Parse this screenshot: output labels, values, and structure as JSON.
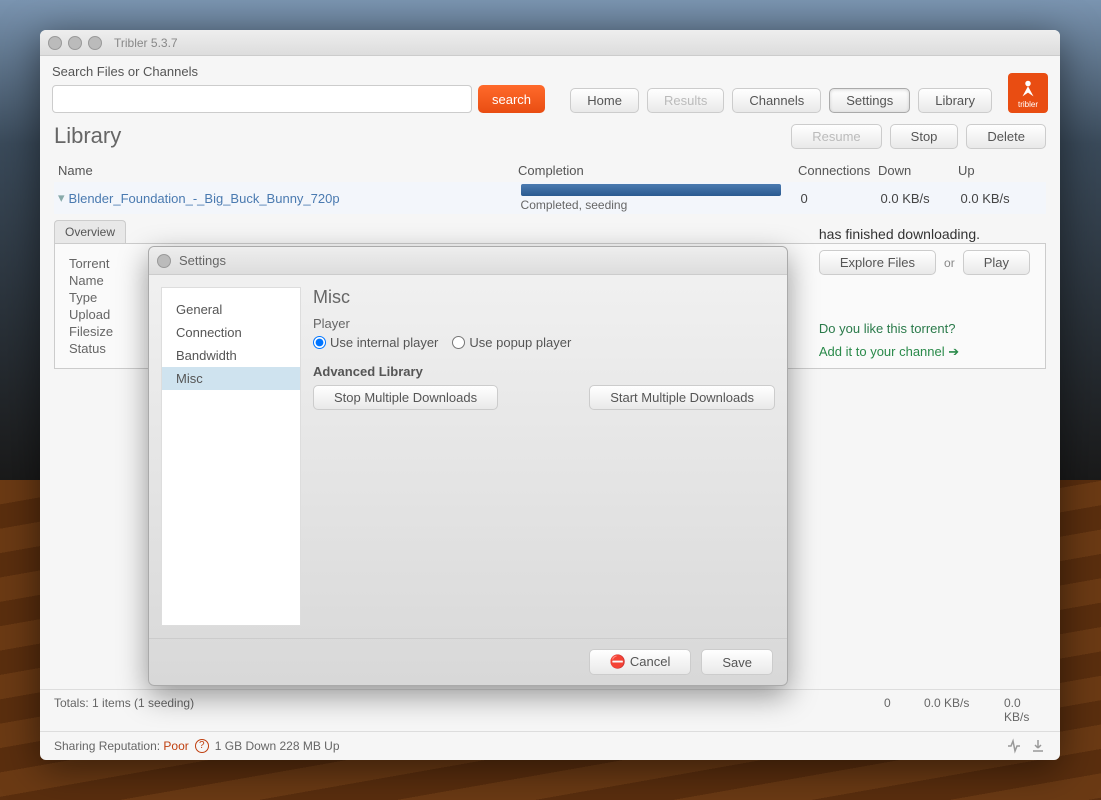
{
  "window": {
    "title": "Tribler 5.3.7"
  },
  "search": {
    "label": "Search Files or Channels",
    "placeholder": "",
    "button": "search"
  },
  "nav": {
    "home": "Home",
    "results": "Results",
    "channels": "Channels",
    "settings": "Settings",
    "library": "Library",
    "logo": "tribler"
  },
  "library": {
    "title": "Library",
    "actions": {
      "resume": "Resume",
      "stop": "Stop",
      "delete": "Delete"
    },
    "columns": {
      "name": "Name",
      "completion": "Completion",
      "connections": "Connections",
      "down": "Down",
      "up": "Up"
    },
    "row": {
      "name": "Blender_Foundation_-_Big_Buck_Bunny_720p",
      "status": "Completed, seeding",
      "connections": "0",
      "down": "0.0 KB/s",
      "up": "0.0 KB/s"
    },
    "detail_tabs": [
      "Overview",
      "Torrent",
      "Name",
      "Type",
      "Upload",
      "Filesize",
      "Status"
    ],
    "finished_msg": "has finished downloading.",
    "explore": "Explore Files",
    "or": "or",
    "play": "Play",
    "like_q": "Do you like this torrent?",
    "share": "Add it to your channel ➔"
  },
  "totals": {
    "line": "Totals: 1 items (1 seeding)",
    "conn": "0",
    "down": "0.0 KB/s",
    "up": "0.0 KB/s"
  },
  "status": {
    "label": "Sharing Reputation:",
    "value": "Poor",
    "traffic": "1 GB Down 228 MB Up"
  },
  "dialog": {
    "title": "Settings",
    "categories": [
      "General",
      "Connection",
      "Bandwidth",
      "Misc"
    ],
    "selected": "Misc",
    "heading": "Misc",
    "player_label": "Player",
    "radio_internal": "Use internal player",
    "radio_popup": "Use popup player",
    "adv_heading": "Advanced Library",
    "stop_multi": "Stop Multiple Downloads",
    "start_multi": "Start Multiple Downloads",
    "cancel": "Cancel",
    "save": "Save"
  }
}
